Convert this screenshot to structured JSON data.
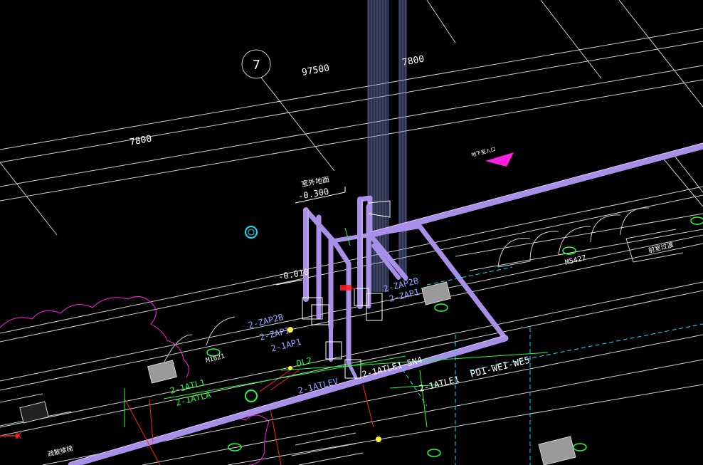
{
  "view": {
    "background": "#000000",
    "colors": {
      "grid_line": "#cfcfcf",
      "pipe": "#a890e8",
      "pipe_edge": "#d8ccff",
      "cyan": "#00e5ff",
      "magenta": "#ff1fe0",
      "yellow": "#ffff33",
      "green": "#22ff33",
      "red": "#ff2020",
      "blue_text": "#9aa0ff",
      "white": "#ffffff"
    }
  },
  "grid": {
    "axis_label": "7",
    "dimensions": [
      "97500",
      "7800",
      "7800"
    ]
  },
  "elevations": {
    "outdoor_label": "室外地面",
    "outdoor_value": "-0.300",
    "floor_value": "-0.010"
  },
  "pipe_labels": {
    "zap2b_left": "2-ZAP2B",
    "zap1_a": "2-ZAP1",
    "zap1_b": "2-1AP1",
    "zap2b_right": "2-ZAP2B",
    "zap_right_2": "2-ZAP1",
    "atl_a": "2-1ATLE1-5N4",
    "atl_b": "2-1ATLE1",
    "atl_left_1": "2-1ATL1",
    "atl_left_2": "2-1ATLA",
    "pdi": "PDI-WEI-WE5",
    "dl2": "DL2",
    "atlev": "2-1ATLEV"
  },
  "door_tags": {
    "m1": "M1621",
    "m5427": "M5427"
  },
  "room_labels": {
    "right": "前室过渡",
    "bottom_left": "疏散楼梯",
    "entrance": "地下室入口"
  },
  "ucs": {
    "x": "X"
  }
}
